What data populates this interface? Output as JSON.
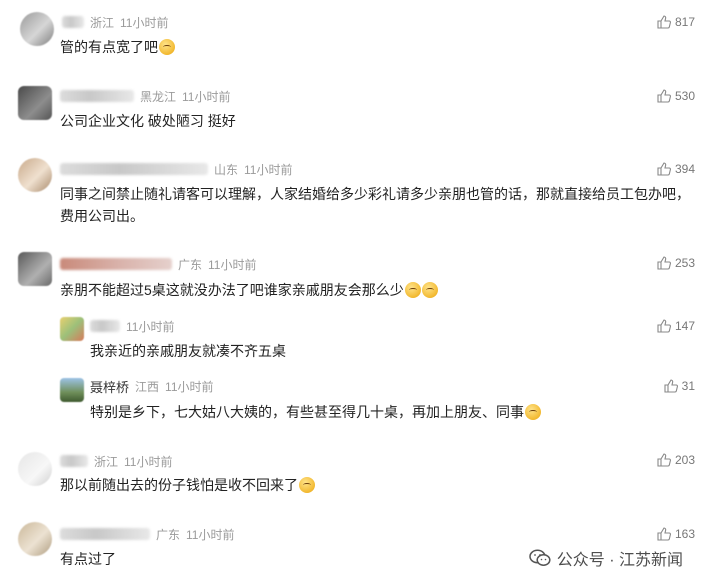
{
  "comments": [
    {
      "location": "浙江",
      "time": "11小时前",
      "text": "管的有点宽了吧",
      "likes": "817",
      "emoji": "tear-laugh"
    },
    {
      "location": "黑龙江",
      "time": "11小时前",
      "text": "公司企业文化  破处陋习  挺好",
      "likes": "530"
    },
    {
      "location": "山东",
      "time": "11小时前",
      "text": "同事之间禁止随礼请客可以理解，人家结婚给多少彩礼请多少亲朋也管的话，那就直接给员工包办吧，费用公司出。",
      "likes": "394"
    },
    {
      "location": "广东",
      "time": "11小时前",
      "text": "亲朋不能超过5桌这就没办法了吧谁家亲戚朋友会那么少",
      "likes": "253",
      "emoji": "worried x2",
      "replies": [
        {
          "time": "11小时前",
          "text": "我亲近的亲戚朋友就凑不齐五桌",
          "likes": "147"
        },
        {
          "name": "聂梓桥",
          "location": "江西",
          "time": "11小时前",
          "text": "特别是乡下，七大姑八大姨的，有些甚至得几十桌，再加上朋友、同事",
          "likes": "31",
          "emoji": "tear-laugh"
        }
      ]
    },
    {
      "location": "浙江",
      "time": "11小时前",
      "text": "那以前随出去的份子钱怕是收不回来了",
      "likes": "203",
      "emoji": "thinking"
    },
    {
      "location": "广东",
      "time": "11小时前",
      "text": "有点过了",
      "likes": "163"
    }
  ],
  "footer": {
    "text": "公众号 · 江苏新闻",
    "icon": "wechat-icon"
  },
  "colors": {
    "meta": "#9a9a9a",
    "text": "#222222",
    "likes": "#777777"
  }
}
